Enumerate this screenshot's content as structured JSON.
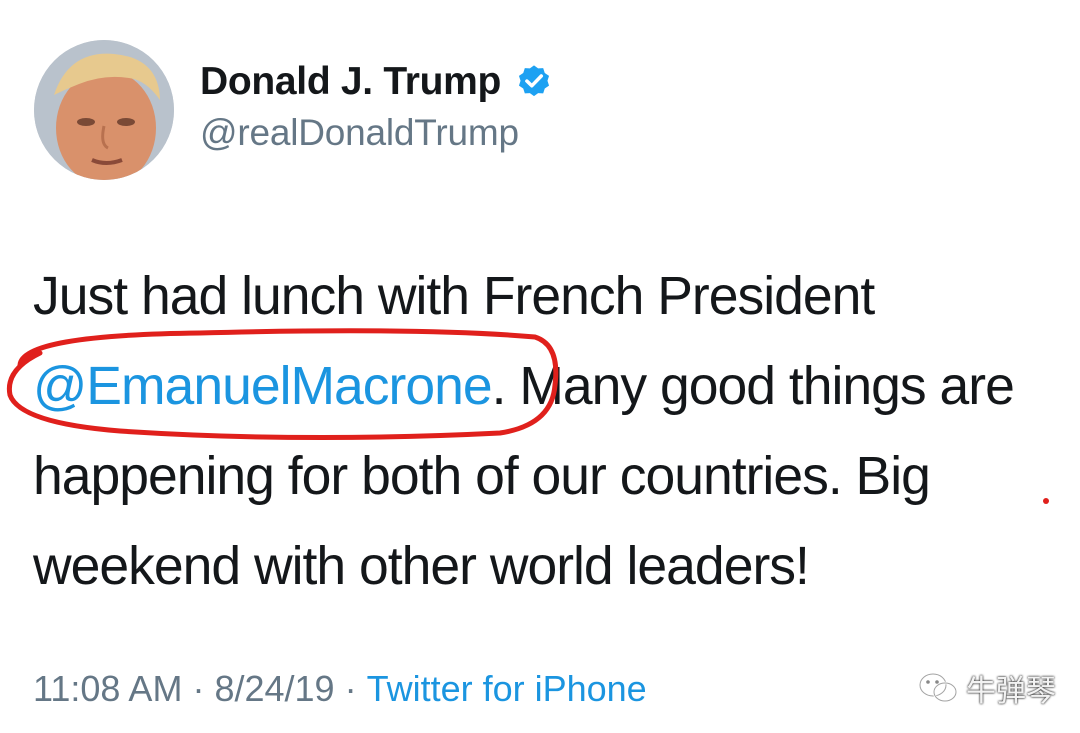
{
  "author": {
    "display_name": "Donald J. Trump",
    "handle": "@realDonaldTrump",
    "verified": true,
    "verified_icon": "verified-badge-icon"
  },
  "tweet": {
    "text_part1": "Just had lunch with French President ",
    "mention": "@EmanuelMacrone",
    "text_part2": ". Many good things are happening for both of our countries. Big weekend with other world leaders!"
  },
  "meta": {
    "time": "11:08 AM",
    "separator": "·",
    "date": "8/24/19",
    "source": "Twitter for iPhone"
  },
  "watermark": {
    "text": "牛弹琴",
    "icon": "wechat-icon"
  },
  "colors": {
    "link": "#1b95e0",
    "secondary": "#657786",
    "highlight": "#e0201c"
  }
}
